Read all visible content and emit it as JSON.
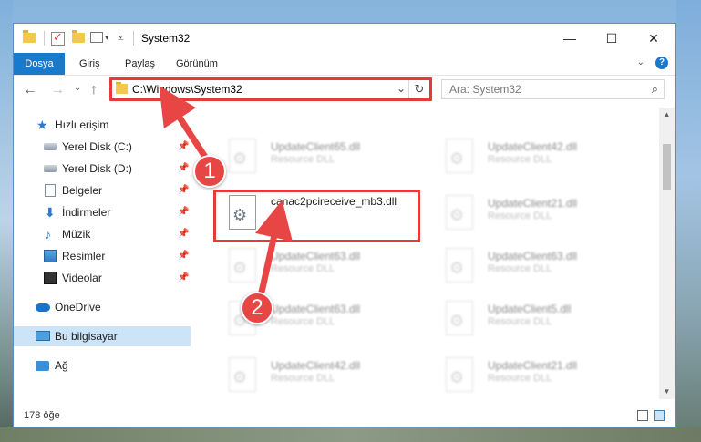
{
  "window": {
    "title": "System32",
    "minimize": "—",
    "maximize": "☐",
    "close": "✕"
  },
  "ribbon": {
    "tabs": [
      "Dosya",
      "Giriş",
      "Paylaş",
      "Görünüm"
    ],
    "expand": "⌄",
    "help": "?"
  },
  "nav": {
    "back": "←",
    "forward": "→",
    "recent": "⌄",
    "up": "↑"
  },
  "address": {
    "path": "C:\\Windows\\System32",
    "chevron": "⌄",
    "refresh": "↻"
  },
  "search": {
    "placeholder": "Ara: System32",
    "icon": "⌕"
  },
  "sidebar": {
    "quick_access": "Hızlı erişim",
    "items": [
      {
        "label": "Yerel Disk (C:)",
        "icon": "drive-icon"
      },
      {
        "label": "Yerel Disk (D:)",
        "icon": "drive-icon"
      },
      {
        "label": "Belgeler",
        "icon": "documents-icon"
      },
      {
        "label": "İndirmeler",
        "icon": "downloads-icon"
      },
      {
        "label": "Müzik",
        "icon": "music-icon"
      },
      {
        "label": "Resimler",
        "icon": "pictures-icon"
      },
      {
        "label": "Videolar",
        "icon": "videos-icon"
      }
    ],
    "pin_glyph": "📌",
    "onedrive": "OneDrive",
    "this_pc": "Bu bilgisayar",
    "network": "Ağ"
  },
  "files": [
    {
      "name": "UpdateClient65.dll",
      "desc": "Resource DLL"
    },
    {
      "name": "UpdateClient42.dll",
      "desc": "Resource DLL"
    },
    {
      "name": "canac2pcireceive_mb3.dll",
      "desc": ""
    },
    {
      "name": "UpdateClient21.dll",
      "desc": "Resource DLL"
    },
    {
      "name": "UpdateClient63.dll",
      "desc": "Resource DLL"
    },
    {
      "name": "UpdateClient63.dll",
      "desc": "Resource DLL"
    },
    {
      "name": "UpdateClient63.dll",
      "desc": "Resource DLL"
    },
    {
      "name": "UpdateClient5.dll",
      "desc": "Resource DLL"
    },
    {
      "name": "UpdateClient42.dll",
      "desc": "Resource DLL"
    },
    {
      "name": "UpdateClient21.dll",
      "desc": "Resource DLL"
    }
  ],
  "status": {
    "count": "178 öğe"
  },
  "annotations": {
    "step1": "1",
    "step2": "2",
    "color": "#e84545"
  }
}
